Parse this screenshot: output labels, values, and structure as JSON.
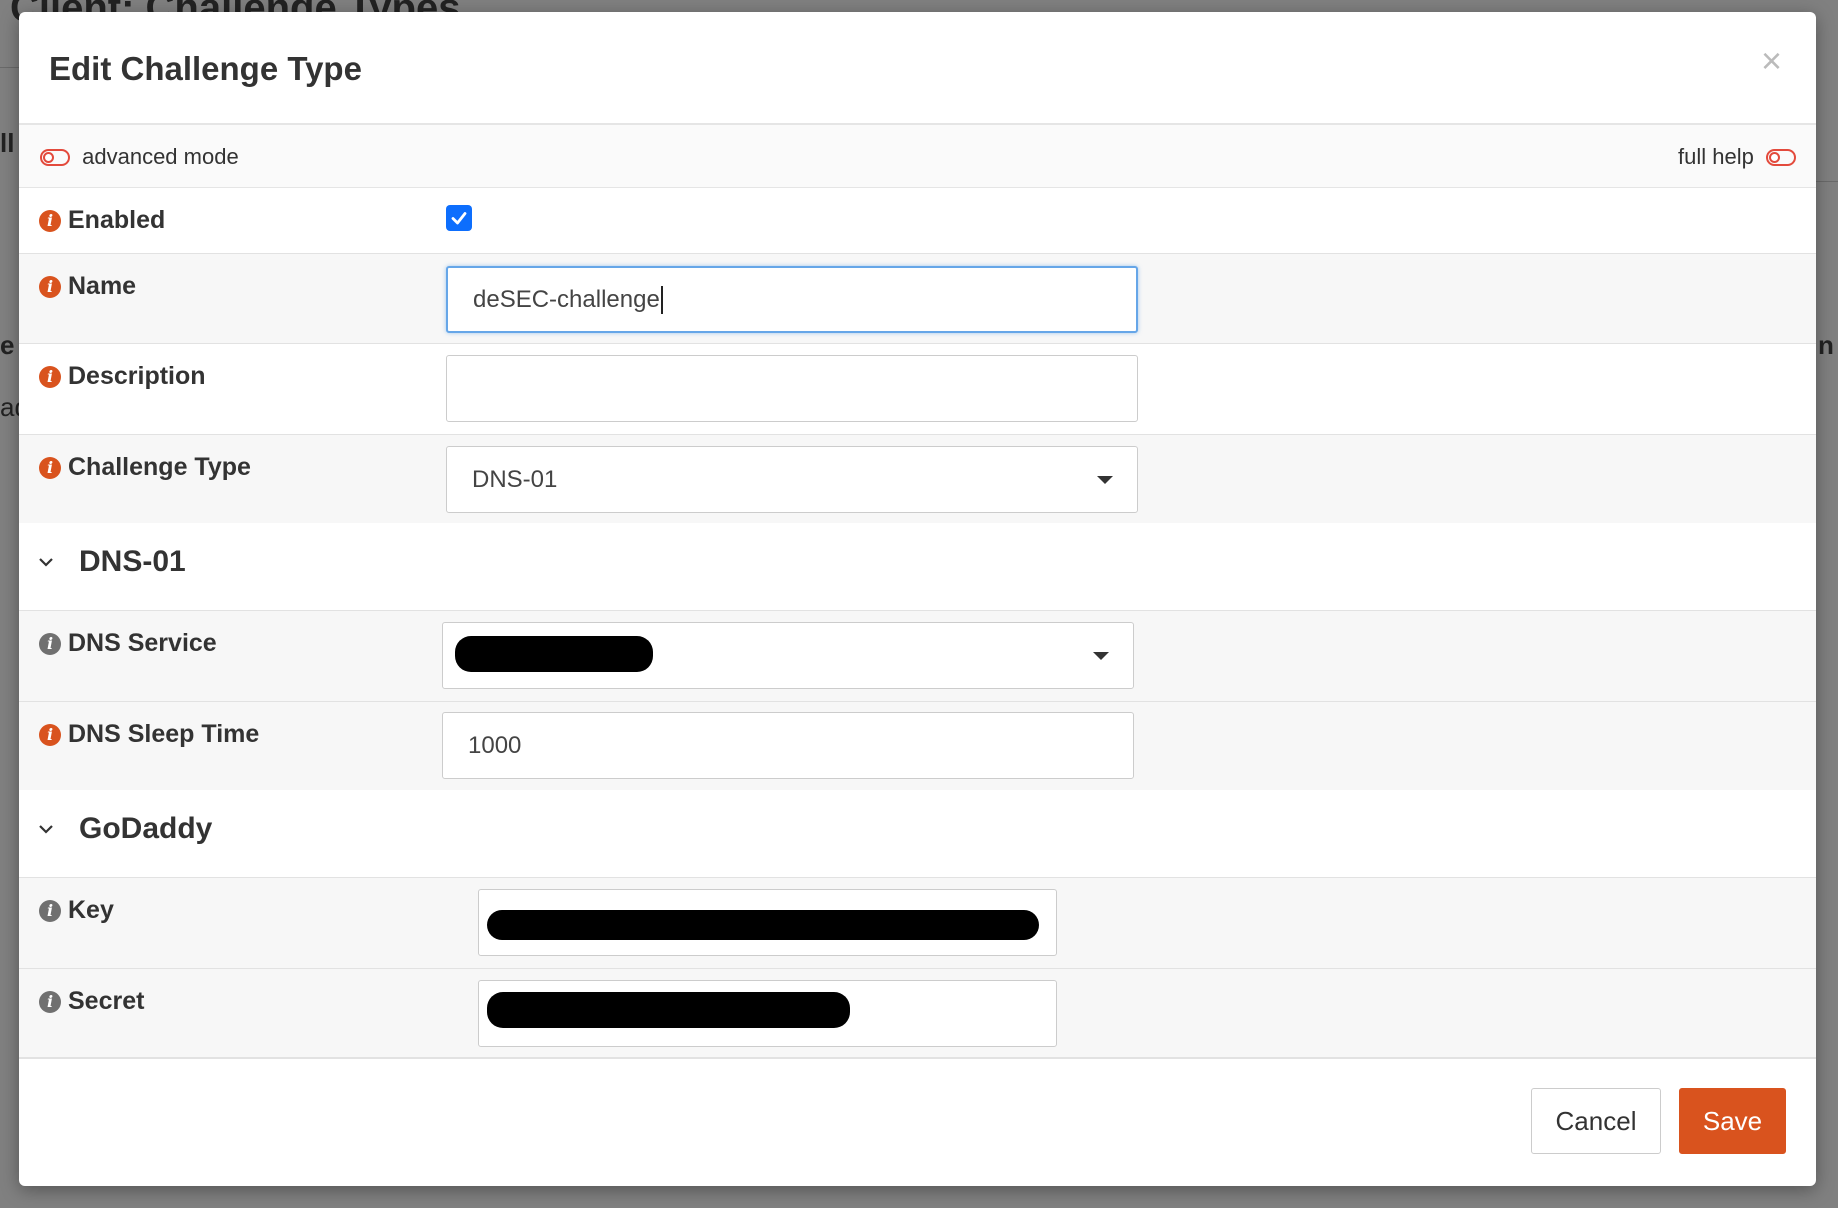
{
  "background": {
    "page_title": "Client: Challenge Types",
    "fragments": [
      "ll",
      "e",
      "ad",
      "n"
    ]
  },
  "modal": {
    "title": "Edit Challenge Type",
    "close_label": "×",
    "advanced_mode_label": "advanced mode",
    "full_help_label": "full help"
  },
  "fields": {
    "enabled": {
      "label": "Enabled",
      "checked": true
    },
    "name": {
      "label": "Name",
      "value": "deSEC-challenge"
    },
    "description": {
      "label": "Description",
      "value": ""
    },
    "challenge_type": {
      "label": "Challenge Type",
      "value": "DNS-01"
    }
  },
  "sections": {
    "dns01": {
      "title": "DNS-01",
      "dns_service": {
        "label": "DNS Service",
        "value": "[redacted]"
      },
      "dns_sleep_time": {
        "label": "DNS Sleep Time",
        "value": "1000"
      }
    },
    "godaddy": {
      "title": "GoDaddy",
      "key": {
        "label": "Key",
        "value": "[redacted]"
      },
      "secret": {
        "label": "Secret",
        "value": "[redacted]"
      }
    }
  },
  "footer": {
    "cancel_label": "Cancel",
    "save_label": "Save"
  },
  "colors": {
    "accent": "#d9531e",
    "focus": "#66a6e8",
    "checkbox": "#0d6efd",
    "info_grey": "#707070"
  }
}
